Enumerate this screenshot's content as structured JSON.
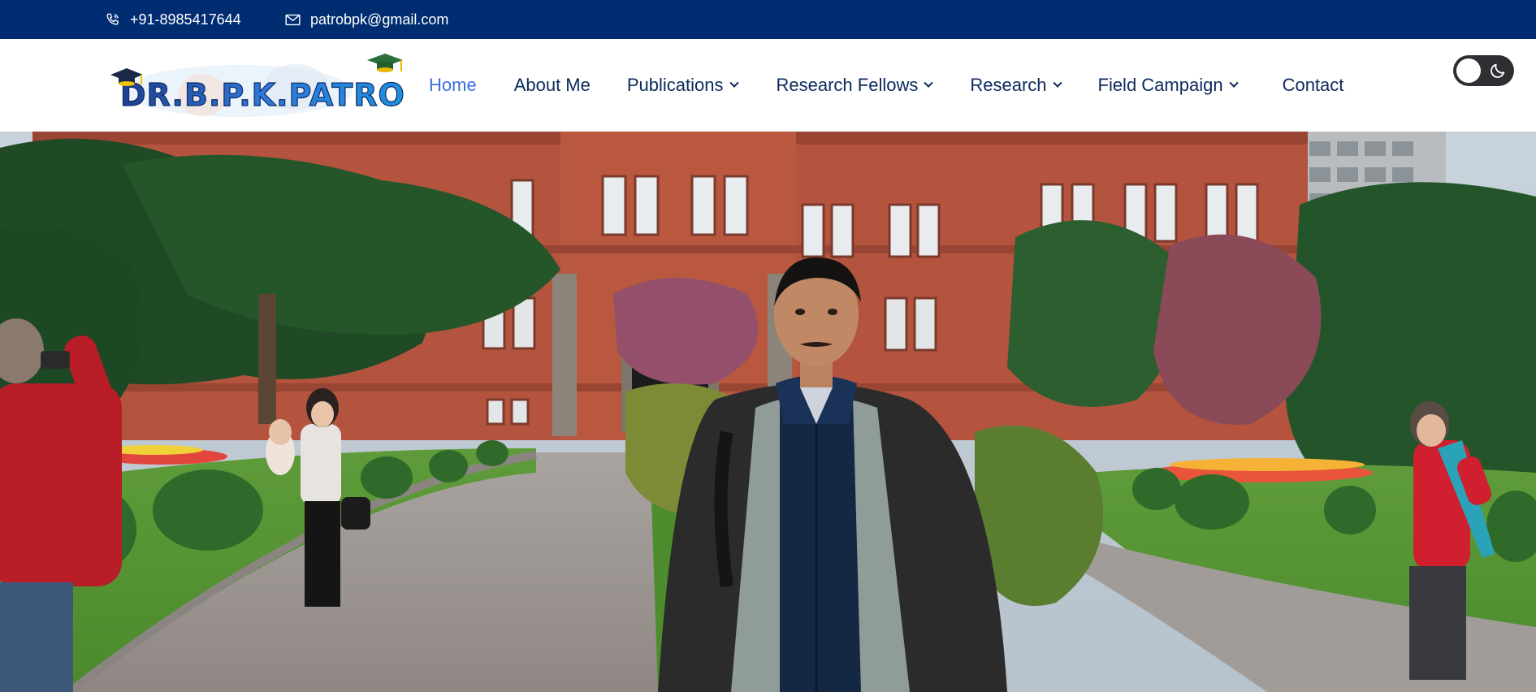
{
  "topbar": {
    "phone": "+91-8985417644",
    "email": "patrobpk@gmail.com",
    "phone_icon": "phone-icon",
    "email_icon": "envelope-icon",
    "background": "#002d72"
  },
  "logo": {
    "text": "DR.B.P.K.PATRO",
    "icon": "graduation-cap-icon"
  },
  "nav": {
    "items": [
      {
        "label": "Home",
        "active": true
      },
      {
        "label": "About Me"
      },
      {
        "label": "Publications",
        "dropdown": true
      },
      {
        "label": "Research Fellows",
        "dropdown": true
      },
      {
        "label": "Research",
        "dropdown": true
      },
      {
        "label": "Field Campaign",
        "dropdown": true
      },
      {
        "label": "Contact"
      }
    ],
    "active_color": "#3b6ee0",
    "text_color": "#0b2a5c"
  },
  "theme_toggle": {
    "icon": "moon-icon",
    "state": "light"
  },
  "hero": {
    "description_icon": "hero-photo"
  }
}
